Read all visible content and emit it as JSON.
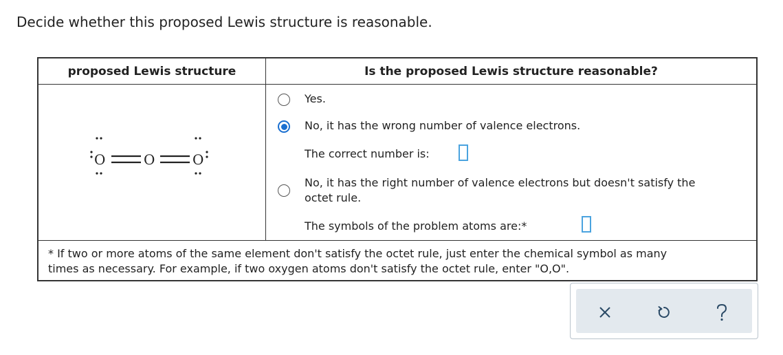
{
  "instruction": "Decide whether this proposed Lewis structure is reasonable.",
  "table": {
    "header_left": "proposed Lewis structure",
    "header_right": "Is the proposed Lewis structure reasonable?"
  },
  "lewis": {
    "atoms": [
      "O",
      "O",
      "O"
    ],
    "bonds": [
      "double",
      "double"
    ]
  },
  "options": [
    {
      "label": "Yes.",
      "selected": false
    },
    {
      "label": "No, it has the wrong number of valence electrons.",
      "selected": true
    },
    {
      "label_line1": "No, it has the right number of valence electrons but doesn't satisfy the",
      "label_line2": "octet rule.",
      "selected": false
    }
  ],
  "sub_prompts": {
    "correct_number": "The correct number is:",
    "correct_number_value": "",
    "problem_atoms": "The symbols of the problem atoms are:*",
    "problem_atoms_value": ""
  },
  "footnote": {
    "line1": "* If two or more atoms of the same element don't satisfy the octet rule, just enter the chemical symbol as many",
    "line2": "times as necessary. For example, if two oxygen atoms don't satisfy the octet rule, enter \"O,O\"."
  },
  "colors": {
    "accent": "#1a6fd0",
    "answer_box_border": "#4aa3df",
    "toolbar_bg": "#e3e9ee",
    "icon": "#2b4a66"
  },
  "toolbar": {
    "icons": [
      "close-icon",
      "undo-icon",
      "help-icon"
    ]
  }
}
